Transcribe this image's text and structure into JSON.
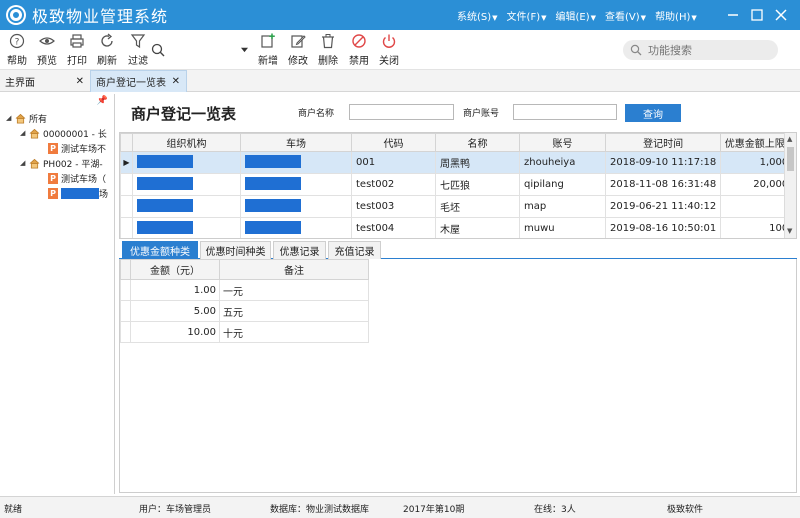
{
  "app": {
    "title": "极致物业管理系统"
  },
  "menus": [
    {
      "label": "系统(S)"
    },
    {
      "label": "文件(F)"
    },
    {
      "label": "编辑(E)"
    },
    {
      "label": "查看(V)"
    },
    {
      "label": "帮助(H)"
    }
  ],
  "toolbar": {
    "help": "帮助",
    "preview": "预览",
    "print": "打印",
    "refresh": "刷新",
    "filter": "过滤",
    "add": "新增",
    "edit": "修改",
    "delete": "删除",
    "disable": "禁用",
    "close": "关闭",
    "search_placeholder": "功能搜索"
  },
  "doc_tabs": [
    {
      "label": "主界面"
    },
    {
      "label": "商户登记一览表"
    }
  ],
  "tree": {
    "root": "所有",
    "n1": "00000001 - 长",
    "n1c1": "测试车场不",
    "n2": "PH002 - 平湖-",
    "n2c1": "测试车场（",
    "n2c2_suffix": "场"
  },
  "page": {
    "title": "商户登记一览表",
    "merchant_name_label": "商户名称",
    "merchant_account_label": "商户账号",
    "query_label": "查询"
  },
  "grid": {
    "columns": [
      "组织机构",
      "车场",
      "代码",
      "名称",
      "账号",
      "登记时间",
      "优惠金额上限("
    ],
    "rows": [
      {
        "code": "001",
        "name": "周黑鸭",
        "account": "zhouheiya",
        "time": "2018-09-10 11:17:18",
        "limit": "1,000"
      },
      {
        "code": "test002",
        "name": "七匹狼",
        "account": "qipilang",
        "time": "2018-11-08 16:31:48",
        "limit": "20,000"
      },
      {
        "code": "test003",
        "name": "毛坯",
        "account": "map",
        "time": "2019-06-21 11:40:12",
        "limit": ""
      },
      {
        "code": "test004",
        "name": "木屋",
        "account": "muwu",
        "time": "2019-08-16 10:50:01",
        "limit": "100"
      }
    ]
  },
  "sub_tabs": [
    "优惠金额种类",
    "优惠时间种类",
    "优惠记录",
    "充值记录"
  ],
  "detail": {
    "columns": [
      "金额（元）",
      "备注"
    ],
    "rows": [
      {
        "amount": "1.00",
        "note": "一元"
      },
      {
        "amount": "5.00",
        "note": "五元"
      },
      {
        "amount": "10.00",
        "note": "十元"
      }
    ]
  },
  "status": {
    "state": "就绪",
    "user": "用户：车场管理员",
    "db": "数据库：物业测试数据库",
    "period": "2017年第10期",
    "online": "在线：3人",
    "vendor": "极致软件"
  },
  "colors": {
    "accent": "#2b8fd6",
    "button": "#2b7fd0",
    "tag": "#f07b3e",
    "mask": "#1f6fd3"
  }
}
